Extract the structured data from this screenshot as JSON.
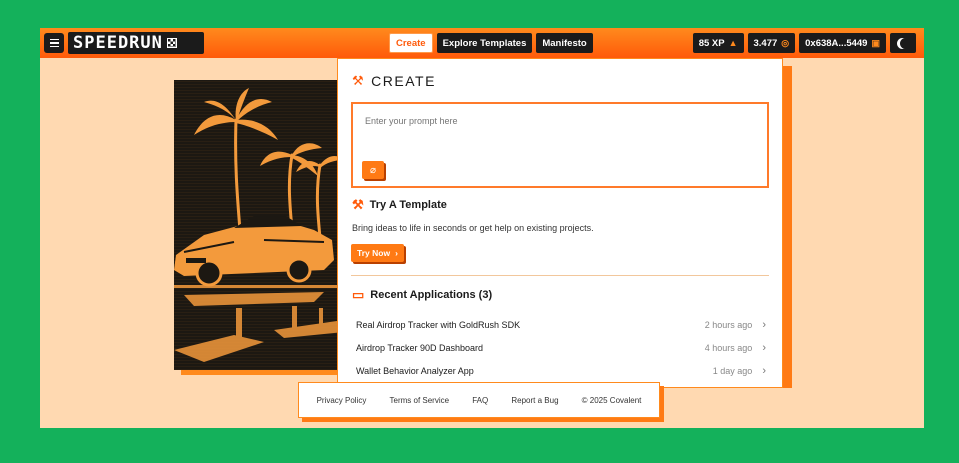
{
  "header": {
    "logo_text": "SPEEDRUN",
    "nav": [
      {
        "label": "Create",
        "active": true
      },
      {
        "label": "Explore Templates",
        "active": false
      },
      {
        "label": "Manifesto",
        "active": false
      }
    ],
    "xp": "85 XP",
    "balance": "3.477",
    "wallet": "0x638A...5449"
  },
  "create": {
    "title": "CREATE",
    "prompt_placeholder": "Enter your prompt here"
  },
  "template": {
    "title": "Try A Template",
    "description": "Bring ideas to life in seconds or get help on existing projects.",
    "button_label": "Try Now"
  },
  "recent": {
    "title": "Recent Applications (3)",
    "items": [
      {
        "name": "Real Airdrop Tracker with GoldRush SDK",
        "time": "2 hours ago"
      },
      {
        "name": "Airdrop Tracker 90D Dashboard",
        "time": "4 hours ago"
      },
      {
        "name": "Wallet Behavior Analyzer App",
        "time": "1 day ago"
      }
    ]
  },
  "footer": {
    "links": [
      "Privacy Policy",
      "Terms of Service",
      "FAQ",
      "Report a Bug"
    ],
    "copyright": "© 2025 Covalent"
  },
  "colors": {
    "accent": "#ff7a14",
    "background": "#ffd9b1",
    "outer": "#14b15b",
    "dark": "#1b1b1b"
  }
}
